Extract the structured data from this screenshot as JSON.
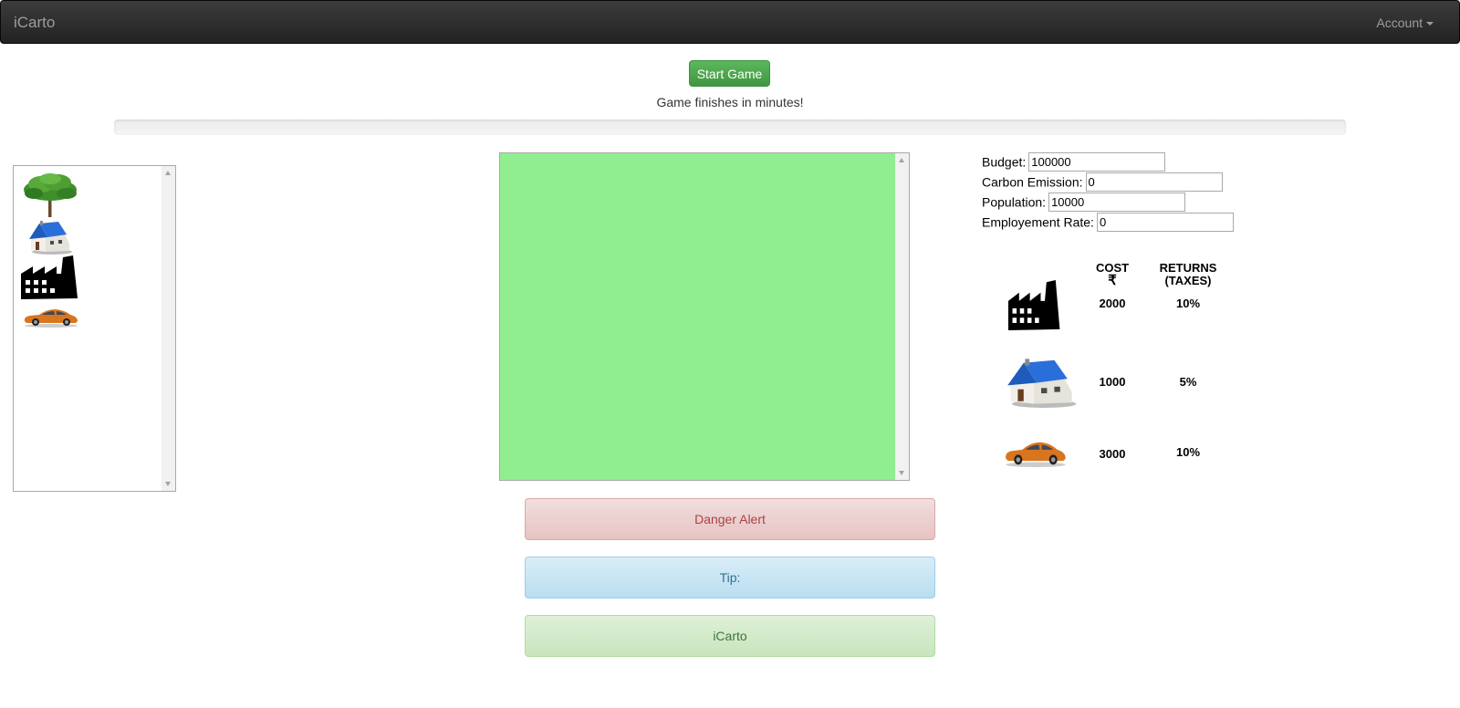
{
  "navbar": {
    "brand": "iCarto",
    "account_label": "Account"
  },
  "controls": {
    "start_button": "Start Game",
    "finish_text": "Game finishes in minutes!",
    "progress_percent": 0
  },
  "palette": {
    "items": [
      {
        "name": "tree",
        "icon": "tree-icon"
      },
      {
        "name": "house",
        "icon": "house-icon"
      },
      {
        "name": "factory",
        "icon": "factory-icon"
      },
      {
        "name": "car",
        "icon": "car-icon"
      }
    ]
  },
  "board": {
    "color": "#90ee90"
  },
  "stats": {
    "budget": {
      "label": "Budget:",
      "value": "100000"
    },
    "carbon": {
      "label": "Carbon Emission:",
      "value": "0"
    },
    "population": {
      "label": "Population:",
      "value": "10000"
    },
    "employment": {
      "label": "Employement Rate:",
      "value": "0"
    }
  },
  "info_table": {
    "cost_header": "COST",
    "currency_symbol": "₹",
    "returns_header": "RETURNS",
    "returns_sub": "(TAXES)",
    "rows": [
      {
        "item": "factory",
        "icon": "factory-icon",
        "cost": "2000",
        "returns": "10%"
      },
      {
        "item": "house",
        "icon": "house-icon",
        "cost": "1000",
        "returns": "5%"
      },
      {
        "item": "car",
        "icon": "car-icon",
        "cost": "3000",
        "returns": "10%"
      }
    ]
  },
  "alerts": {
    "danger": "Danger Alert",
    "tip": "Tip:",
    "success": "iCarto"
  }
}
